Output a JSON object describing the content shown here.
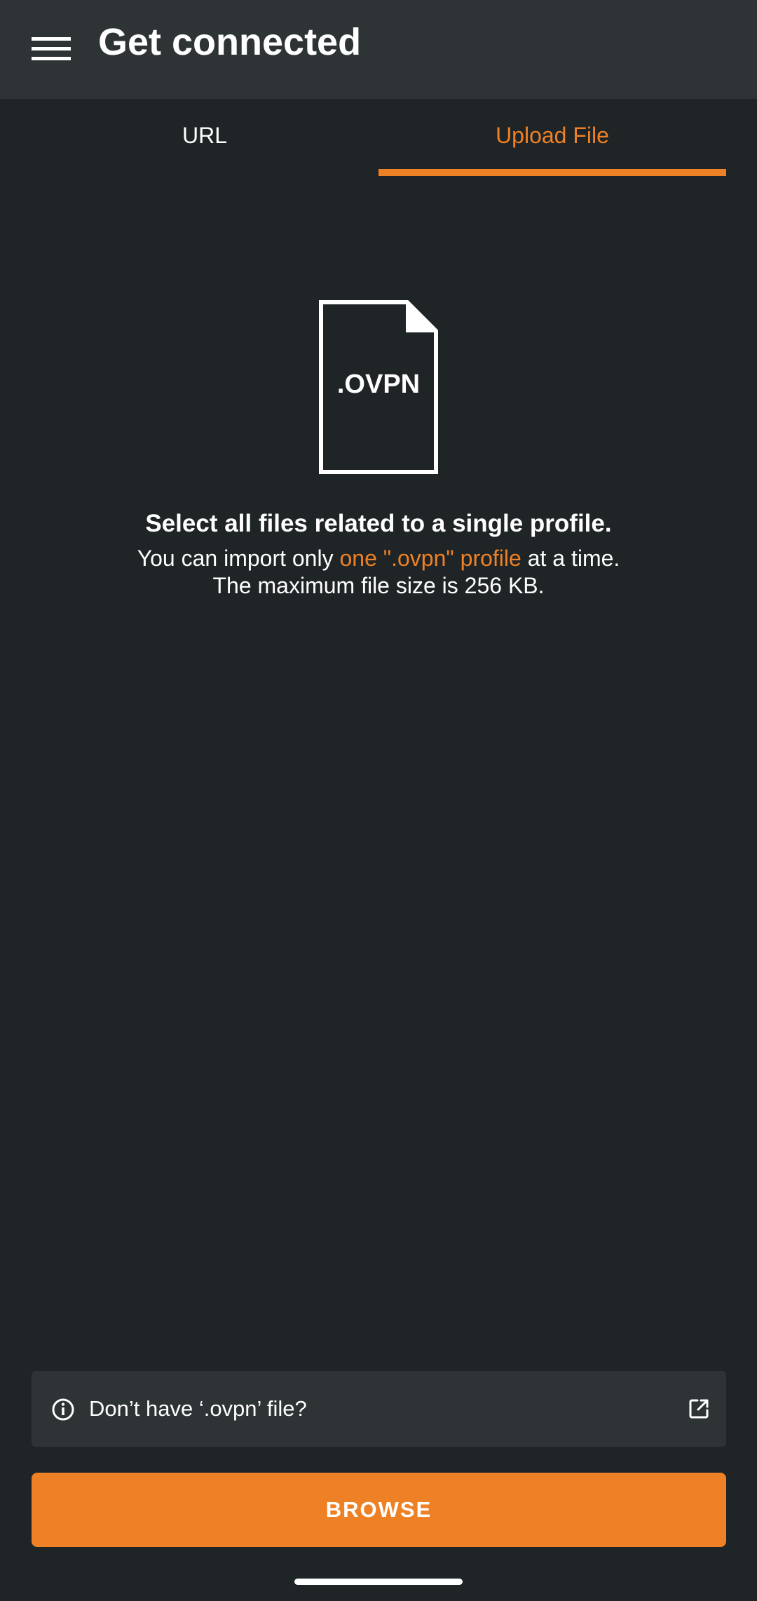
{
  "app_bar": {
    "title": "Get connected",
    "menu_icon": "hamburger-menu-icon"
  },
  "tabs": [
    {
      "label": "URL",
      "selected": false
    },
    {
      "label": "Upload File",
      "selected": true
    }
  ],
  "upload": {
    "file_icon_label": ".OVPN",
    "headline": "Select all files related to a single profile.",
    "desc_part1": "You can import only ",
    "desc_highlight": "one \".ovpn\" profile",
    "desc_part2": " at a time.",
    "desc_line2": "The maximum file size is 256 KB."
  },
  "info_card": {
    "icon": "info-circle-icon",
    "text": "Don’t have ‘.ovpn’ file?",
    "link_icon": "external-link-icon"
  },
  "browse_button": {
    "label": "BROWSE"
  },
  "colors": {
    "accent": "#ee8125",
    "background": "#1f2426",
    "surface": "#2e3436",
    "text": "#ffffff"
  }
}
